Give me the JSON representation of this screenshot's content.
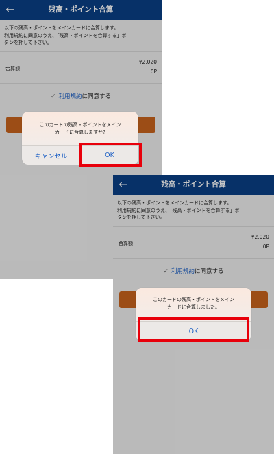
{
  "header": {
    "title": "残高・ポイント合算"
  },
  "description": {
    "line1": "以下の残高・ポイントをメインカードに合算します。",
    "line2": "利用規約に同意のうえ、「残高・ポイントを合算する」ボ",
    "line3": "タンを押して下さい。"
  },
  "amount": {
    "label": "合算額",
    "balance": "¥2,020",
    "points": "0P"
  },
  "agree": {
    "link_text": "利用規約",
    "suffix": "に同意する"
  },
  "dialog_confirm": {
    "line1": "このカードの残高・ポイントをメイン",
    "line2": "カードに合算しますか?",
    "cancel_label": "キャンセル",
    "ok_label": "OK"
  },
  "dialog_done": {
    "line1": "このカードの残高・ポイントをメイン",
    "line2": "カードに合算しました。",
    "ok_label": "OK"
  },
  "colors": {
    "header": "#0a3f86",
    "accent_button": "#c8631d",
    "link": "#1a5ec4",
    "highlight": "#e8000b"
  },
  "icons": {
    "back": "arrow-left-icon",
    "check": "checkmark-icon"
  }
}
